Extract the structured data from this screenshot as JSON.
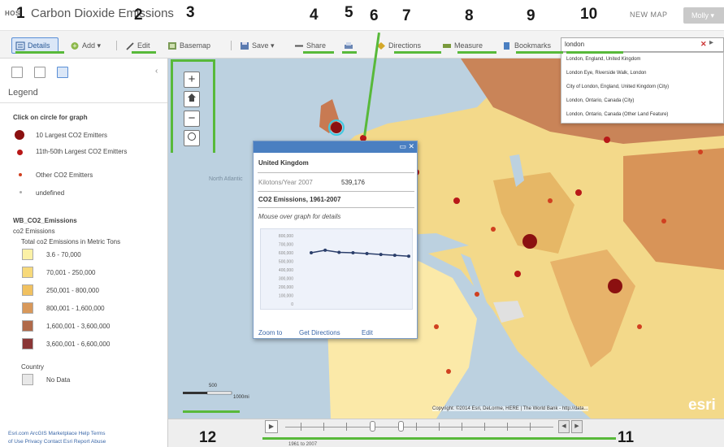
{
  "header": {
    "home_label": "HOS",
    "title": "Carbon Dioxide Emissions",
    "new_map": "NEW MAP",
    "user": "Molly ▾"
  },
  "toolbar": {
    "details": "Details",
    "add": "Add ▾",
    "edit": "Edit",
    "basemap": "Basemap",
    "save": "Save ▾",
    "share": "Share",
    "directions": "Directions",
    "measure": "Measure",
    "bookmarks": "Bookmarks"
  },
  "search": {
    "value": "london",
    "results": [
      "London, England, United Kingdom",
      "London Eye, Riverside Walk, London",
      "City of London, England, United Kingdom (City)",
      "London, Ontario, Canada (City)",
      "London, Ontario, Canada (Other Land Feature)"
    ]
  },
  "legend": {
    "title": "Legend",
    "click_hint": "Click on circle for graph",
    "symbols": [
      {
        "label": "10 Largest CO2 Emitters",
        "color": "#8b1010"
      },
      {
        "label": "11th-50th Largest CO2 Emitters",
        "color": "#b81818"
      },
      {
        "label": "Other CO2 Emitters",
        "color": "#d04020"
      },
      {
        "label": "undefined",
        "color": "#aaaaaa"
      }
    ],
    "layer_name": "WB_CO2_Emissions",
    "layer_sub": "co2 Emissions",
    "class_title": "Total co2 Emissions in Metric Tons",
    "classes": [
      {
        "label": "3.6 - 70,000",
        "color": "#fbf1a6"
      },
      {
        "label": "70,001 - 250,000",
        "color": "#f7d97a"
      },
      {
        "label": "250,001 - 800,000",
        "color": "#f1c160"
      },
      {
        "label": "800,001 - 1,600,000",
        "color": "#d8985a"
      },
      {
        "label": "1,600,001 - 3,600,000",
        "color": "#b06a4a"
      },
      {
        "label": "3,600,001 - 6,600,000",
        "color": "#8a3636"
      }
    ],
    "country_label": "Country",
    "no_data": "No Data",
    "no_data_color": "#e8e8e8"
  },
  "footer_links": {
    "line1": "Esri.com    ArcGIS Marketplace    Help    Terms",
    "line2": "of Use    Privacy    Contact Esri    Report Abuse"
  },
  "map": {
    "scale_label": "1000mi",
    "scale_mid": "500",
    "copyright": "Copyright: ©2014 Esri, DeLorme, HERE | The World Bank - http://data...",
    "esri_logo": "esri",
    "ocean_label": "North Atlantic"
  },
  "popup": {
    "country": "United Kingdom",
    "field_label": "Kilotons/Year 2007",
    "field_value": "539,176",
    "chart_title": "CO2 Emissions, 1961-2007",
    "chart_hint": "Mouse over graph for details",
    "zoom_to": "Zoom to",
    "get_directions": "Get Directions",
    "edit": "Edit"
  },
  "chart_data": {
    "type": "line",
    "title": "CO2 Emissions, 1961-2007",
    "yticks": [
      "800,000",
      "700,000",
      "600,000",
      "500,000",
      "400,000",
      "300,000",
      "200,000",
      "100,000",
      "0"
    ],
    "ylim": [
      0,
      800000
    ],
    "values": [
      600000,
      630000,
      605000,
      600000,
      590000,
      580000,
      570000,
      560000
    ]
  },
  "time_slider": {
    "label": "1961 to 2007"
  },
  "annotations": [
    "1",
    "2",
    "3",
    "4",
    "5",
    "6",
    "7",
    "8",
    "9",
    "10",
    "11",
    "12"
  ]
}
